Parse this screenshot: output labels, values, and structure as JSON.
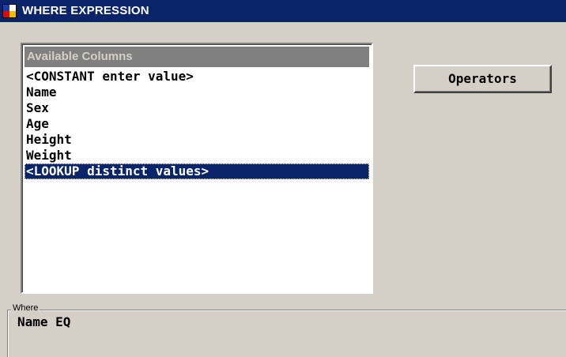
{
  "window": {
    "title": "WHERE EXPRESSION",
    "icon": "sas-app-icon",
    "colors": {
      "titlebar": "#0a246a",
      "face": "#d4d0c8",
      "selection": "#0a246a"
    }
  },
  "columns_list": {
    "header": "Available Columns",
    "items": [
      "<CONSTANT enter value>",
      "Name",
      "Sex",
      "Age",
      "Height",
      "Weight",
      "<LOOKUP distinct values>"
    ],
    "selected_index": 6
  },
  "operators_button": {
    "label": "Operators"
  },
  "where_group": {
    "legend": "Where",
    "expression": "Name EQ"
  }
}
